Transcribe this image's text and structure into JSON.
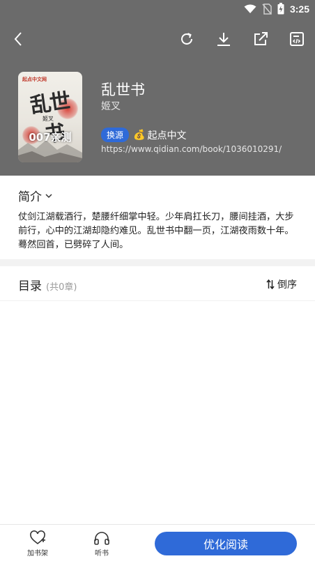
{
  "status": {
    "time": "3:25"
  },
  "book": {
    "title": "乱世书",
    "author": "姬叉",
    "swap_label": "换源",
    "source_name": "起点中文",
    "url": "https://www.qidian.com/book/1036010291/",
    "cover": {
      "badge": "起点中文网",
      "title_art": "乱世书",
      "author_art": "姬叉",
      "overlay": "007亲测"
    }
  },
  "intro": {
    "label": "简介",
    "text": "仗剑江湖载酒行，楚腰纤细掌中轻。少年肩扛长刀，腰间挂酒，大步前行，心中的江湖却隐约难见。乱世书中翻一页，江湖夜雨数十年。蓦然回首，已劈碎了人间。"
  },
  "toc": {
    "label": "目录",
    "count": "(共0章)",
    "sort_label": "倒序"
  },
  "bottom": {
    "shelf_label": "加书架",
    "listen_label": "听书",
    "read_label": "优化阅读"
  },
  "colors": {
    "header_bg": "#6b6b6b",
    "accent": "#2f6ad8"
  },
  "icons": {
    "back": "back-arrow-icon",
    "refresh": "refresh-icon",
    "download": "download-icon",
    "share": "share-icon",
    "edit": "edit-source-icon",
    "shelf": "heart-plus-icon",
    "listen": "headphones-icon",
    "sort": "sort-arrows-icon"
  }
}
